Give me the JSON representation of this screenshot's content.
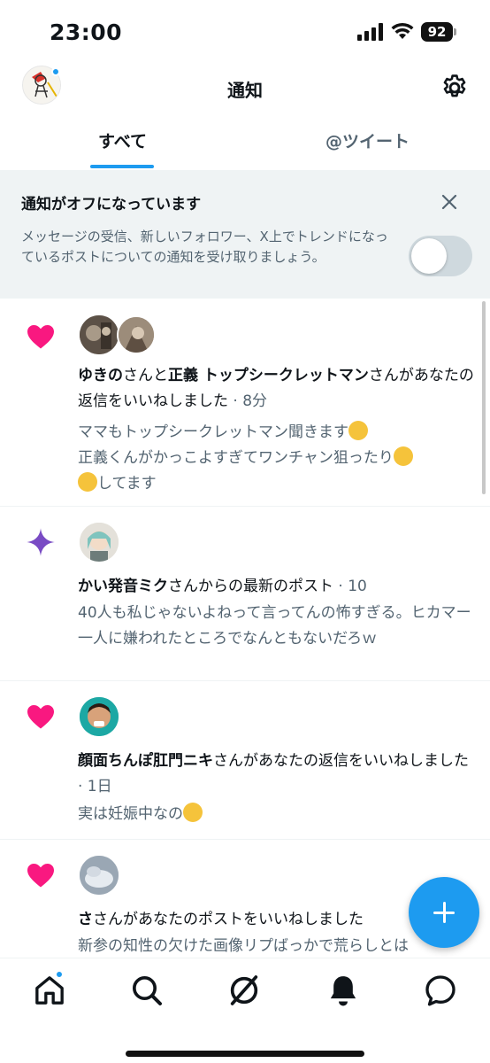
{
  "status_bar": {
    "time": "23:00",
    "battery": "92"
  },
  "header": {
    "title": "通知"
  },
  "tabs": [
    {
      "label": "すべて",
      "active": true
    },
    {
      "label": "@ツイート",
      "active": false
    }
  ],
  "banner": {
    "title": "通知がオフになっています",
    "body": "メッセージの受信、新しいフォロワー、X上でトレンドになっているポストについての通知を受け取りましょう。",
    "toggle_on": false
  },
  "notifications": [
    {
      "type": "like",
      "name1": "ゆきの",
      "connector": "さんと",
      "name2": "正義 トップシークレットマン",
      "action": "さんがあなたの返信をいいねしました",
      "time": "· 8分",
      "preview_line1": "ママもトップシークレットマン聞きます",
      "preview_line2": "正義くんがかっこよすぎてワンチャン狙ったり",
      "preview_line3": "してます"
    },
    {
      "type": "new-post",
      "name1": "かい発音ミク",
      "action": "さんからの最新のポスト",
      "time": "· 10",
      "preview": "40人も私じゃないよねって言ってんの怖すぎる。ヒカマー一人に嫌われたところでなんともないだろｗ"
    },
    {
      "type": "like",
      "name1": "顔面ちんぽ肛門ニキ",
      "action": "さんがあなたの返信をいいねしました",
      "time": "· 1日",
      "preview": "実は妊娠中なの"
    },
    {
      "type": "like",
      "name1": "さ",
      "action": "さんがあなたのポストをいいねしました",
      "time": "",
      "preview": "新参の知性の欠けた画像リプばっかで荒らしとは"
    }
  ],
  "colors": {
    "accent": "#1d9bf0",
    "like": "#f91880",
    "new_post": "#794bc4",
    "secondary_text": "#536471"
  },
  "icons": {
    "like": "heart-icon",
    "new_post": "sparkle-icon",
    "settings": "gear-icon",
    "close": "close-icon"
  }
}
